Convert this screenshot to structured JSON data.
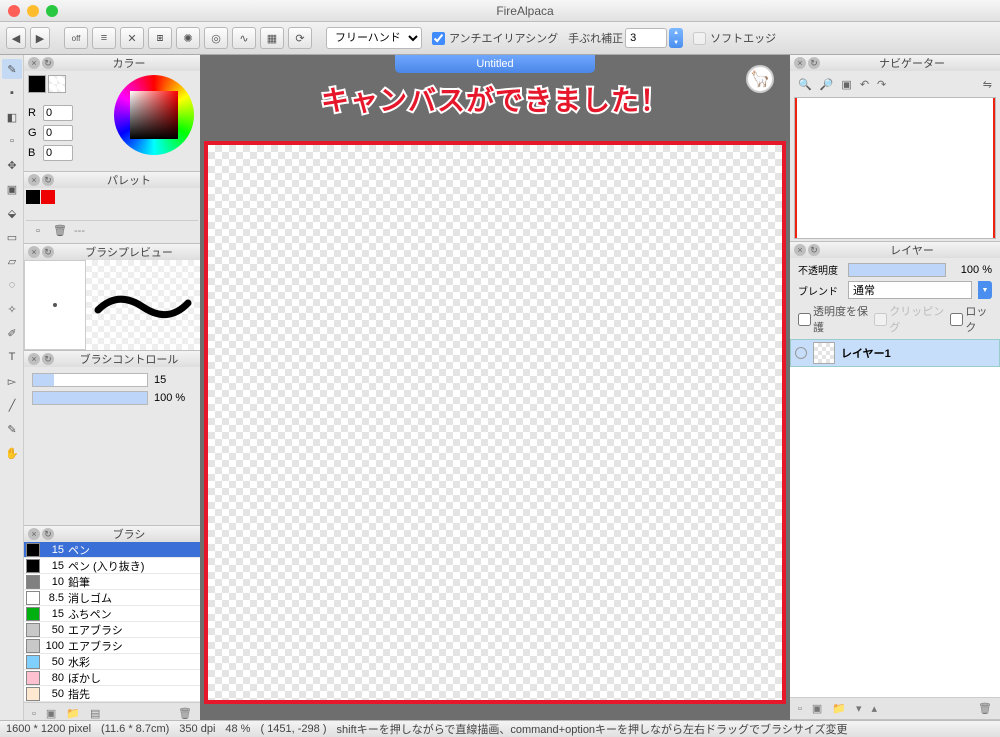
{
  "app": {
    "title": "FireAlpaca"
  },
  "toolbar": {
    "mode": "フリーハンド",
    "antialias_label": "アンチエイリアシング",
    "antialias_checked": true,
    "correction_label": "手ぶれ補正",
    "correction_value": "3",
    "softedge_label": "ソフトエッジ",
    "softedge_checked": false
  },
  "doc_tab": "Untitled",
  "annotation": "キャンバスができました！",
  "panels": {
    "color": {
      "title": "カラー",
      "r": "0",
      "g": "0",
      "b": "0"
    },
    "palette": {
      "title": "パレット",
      "empty": "---"
    },
    "brush_preview": {
      "title": "ブラシプレビュー"
    },
    "brush_control": {
      "title": "ブラシコントロール",
      "size": "15",
      "opacity": "100 %"
    },
    "brush_list": {
      "title": "ブラシ",
      "items": [
        {
          "color": "#000000",
          "size": "15",
          "name": "ペン",
          "selected": true
        },
        {
          "color": "#000000",
          "size": "15",
          "name": "ペン (入り抜き)"
        },
        {
          "color": "#808080",
          "size": "10",
          "name": "鉛筆"
        },
        {
          "color": "#ffffff",
          "size": "8.5",
          "name": "消しゴム"
        },
        {
          "color": "#00b010",
          "size": "15",
          "name": "ふちペン"
        },
        {
          "color": "#c8c8c8",
          "size": "50",
          "name": "エアブラシ"
        },
        {
          "color": "#c8c8c8",
          "size": "100",
          "name": "エアブラシ"
        },
        {
          "color": "#80d0ff",
          "size": "50",
          "name": "水彩"
        },
        {
          "color": "#ffc0d0",
          "size": "80",
          "name": "ぼかし"
        },
        {
          "color": "#ffe8d0",
          "size": "50",
          "name": "指先"
        }
      ]
    },
    "navigator": {
      "title": "ナビゲーター"
    },
    "layer": {
      "title": "レイヤー",
      "opacity_label": "不透明度",
      "opacity_value": "100 %",
      "blend_label": "ブレンド",
      "blend_value": "通常",
      "protect_alpha": "透明度を保護",
      "clipping": "クリッピング",
      "lock": "ロック",
      "layers": [
        {
          "name": "レイヤー1"
        }
      ]
    }
  },
  "status": {
    "dims": "1600 * 1200 pixel",
    "cm": "(11.6 * 8.7cm)",
    "dpi": "350 dpi",
    "zoom": "48 %",
    "coords": "( 1451, -298 )",
    "hint": "shiftキーを押しながらで直線描画、command+optionキーを押しながら左右ドラッグでブラシサイズ変更"
  }
}
